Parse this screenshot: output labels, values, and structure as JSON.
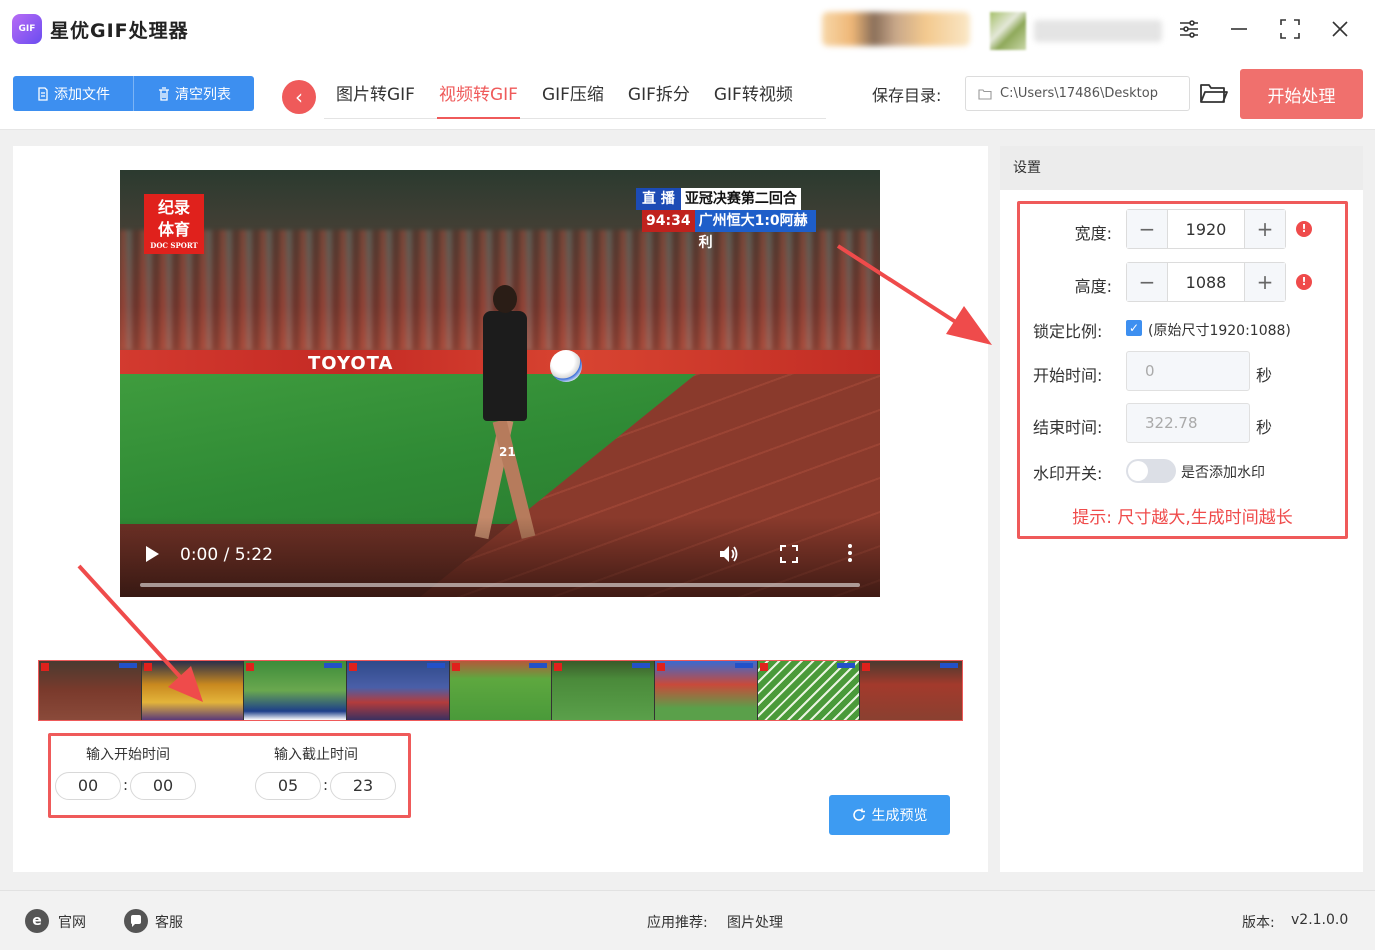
{
  "app": {
    "title": "星优GIF处理器",
    "logo_text": "GIF"
  },
  "toolbar": {
    "add_file": "添加文件",
    "clear_list": "清空列表",
    "tabs": [
      {
        "label": "图片转GIF",
        "active": false
      },
      {
        "label": "视频转GIF",
        "active": true
      },
      {
        "label": "GIF压缩",
        "active": false
      },
      {
        "label": "GIF拆分",
        "active": false
      },
      {
        "label": "GIF转视频",
        "active": false
      }
    ],
    "save_label": "保存目录:",
    "save_path": "C:\\Users\\17486\\Desktop",
    "start_button": "开始处理"
  },
  "video": {
    "logo_line1": "纪录",
    "logo_line2": "体育",
    "logo_sub": "DOC SPORT",
    "live_label": "直 播",
    "match_title": "亚冠决赛第二回合",
    "match_time": "94:34",
    "match_score": "广州恒大1:0阿赫利",
    "ad_text": "TOYOTA",
    "player_number": "21",
    "time_display": "0:00 / 5:22",
    "progress": 0
  },
  "time_range": {
    "start_label": "输入开始时间",
    "end_label": "输入截止时间",
    "start_min": "00",
    "start_sec": "00",
    "end_min": "05",
    "end_sec": "23",
    "colon": ":"
  },
  "preview_button": "生成预览",
  "settings": {
    "header": "设置",
    "width_label": "宽度:",
    "width_value": "1920",
    "height_label": "高度:",
    "height_value": "1088",
    "lock_label": "锁定比例:",
    "lock_checked": true,
    "lock_text": "(原始尺寸1920:1088)",
    "start_time_label": "开始时间:",
    "start_time_value": "0",
    "end_time_label": "结束时间:",
    "end_time_value": "322.78",
    "seconds_unit": "秒",
    "watermark_label": "水印开关:",
    "watermark_text": "是否添加水印",
    "watermark_on": false,
    "tip": "提示: 尺寸越大,生成时间越长"
  },
  "footer": {
    "website": "官网",
    "support": "客服",
    "recommend_label": "应用推荐:",
    "recommend_app": "图片处理",
    "version_label": "版本:",
    "version_value": "v2.1.0.0"
  },
  "colors": {
    "accent_red": "#ef5a5a",
    "primary_blue": "#3d8ff0"
  }
}
